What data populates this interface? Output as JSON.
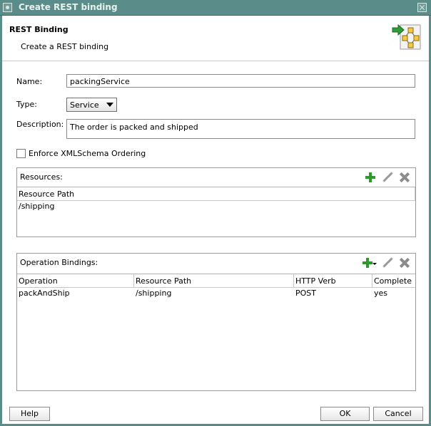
{
  "window": {
    "title": "Create REST binding"
  },
  "header": {
    "title": "REST Binding",
    "subtitle": "Create a REST binding"
  },
  "form": {
    "name_label": "Name:",
    "name_value": "packingService",
    "type_label": "Type:",
    "type_value": "Service",
    "description_label": "Description:",
    "description_value": "The order is packed and shipped",
    "enforce_label": "Enforce XMLSchema Ordering",
    "enforce_checked": false
  },
  "resources": {
    "title": "Resources:",
    "columns": [
      "Resource Path"
    ],
    "rows": [
      [
        "/shipping"
      ]
    ]
  },
  "operations": {
    "title": "Operation Bindings:",
    "columns": [
      "Operation",
      "Resource Path",
      "HTTP Verb",
      "Complete"
    ],
    "rows": [
      [
        "packAndShip",
        "/shipping",
        "POST",
        "yes"
      ]
    ]
  },
  "footer": {
    "help": "Help",
    "ok": "OK",
    "cancel": "Cancel"
  },
  "colors": {
    "titlebar": "#5a8d89",
    "add_green": "#2a9b2a"
  }
}
